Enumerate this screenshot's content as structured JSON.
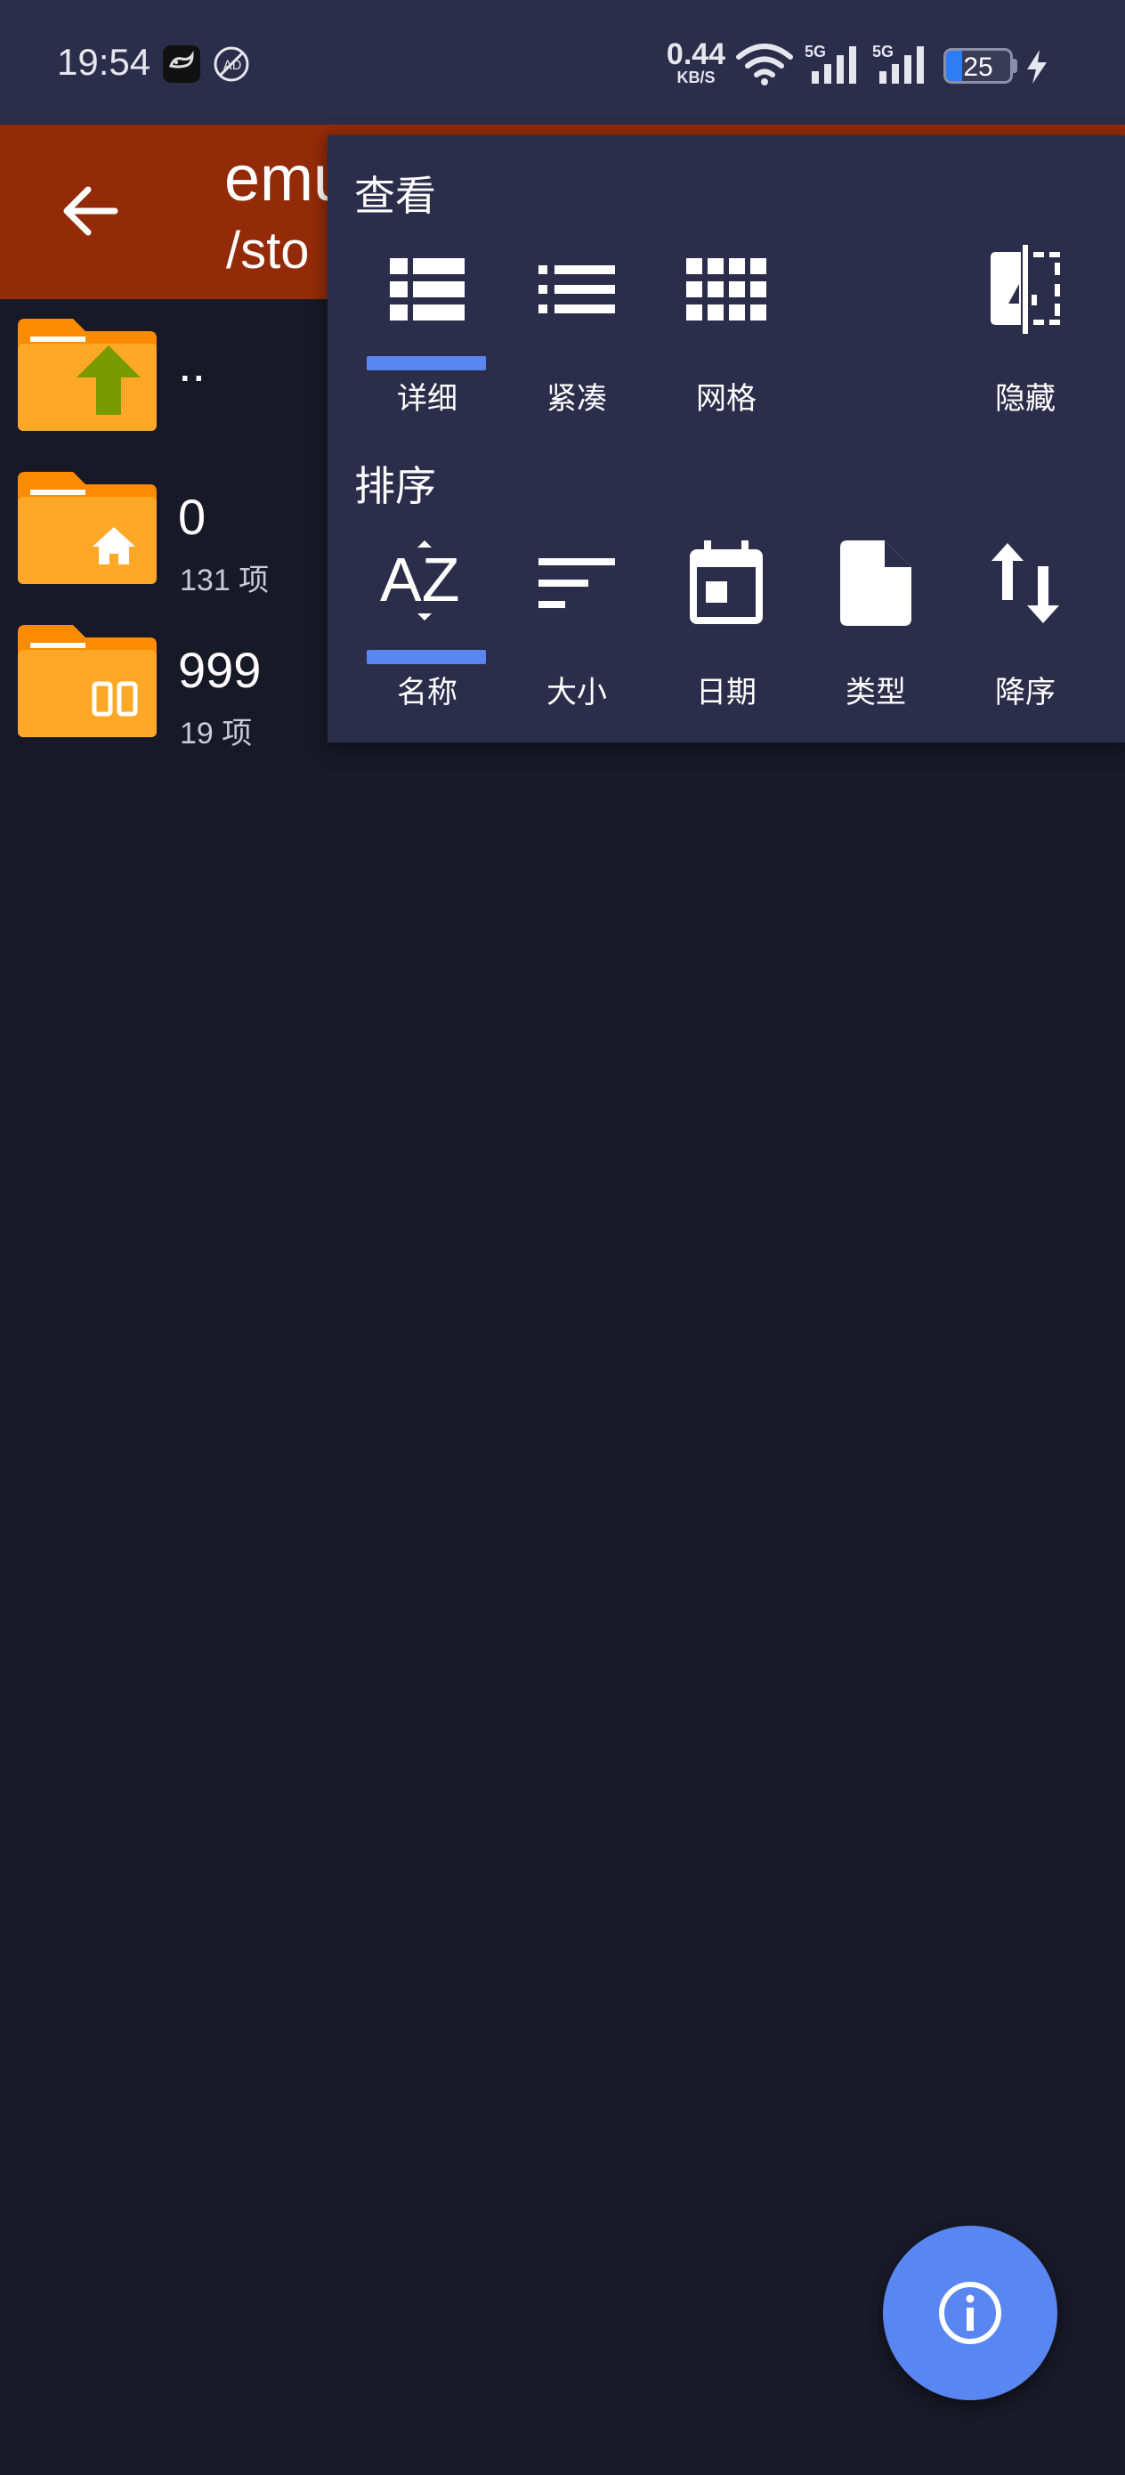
{
  "status_bar": {
    "time": "19:54",
    "net_speed_value": "0.44",
    "net_speed_unit": "KB/S",
    "signal_1_label": "5G",
    "signal_2_label": "5G",
    "battery_level": "25",
    "battery_fraction": 0.25,
    "icons": [
      "notification-app-icon",
      "ad-block-icon",
      "wifi-icon",
      "signal-icon",
      "signal-icon",
      "battery-icon",
      "charging-icon"
    ]
  },
  "app_bar": {
    "title_visible": "emu",
    "path_visible": "/sto"
  },
  "file_list": [
    {
      "name": "..",
      "count": "",
      "icon": "folder-up-icon"
    },
    {
      "name": "0",
      "count": "131 项",
      "icon": "folder-home-icon"
    },
    {
      "name": "999",
      "count": "19 项",
      "icon": "folder-dual-icon"
    }
  ],
  "popup": {
    "view_title": "查看",
    "view_options": [
      {
        "label": "详细",
        "icon": "list-detail-icon",
        "selected": true
      },
      {
        "label": "紧凑",
        "icon": "list-compact-icon",
        "selected": false
      },
      {
        "label": "网格",
        "icon": "grid-icon",
        "selected": false
      },
      {
        "label": "隐藏",
        "icon": "hidden-files-icon",
        "selected": false
      }
    ],
    "sort_title": "排序",
    "sort_options": [
      {
        "label": "名称",
        "icon": "sort-az-icon",
        "selected": true
      },
      {
        "label": "大小",
        "icon": "sort-size-icon",
        "selected": false
      },
      {
        "label": "日期",
        "icon": "calendar-icon",
        "selected": false
      },
      {
        "label": "类型",
        "icon": "file-type-icon",
        "selected": false
      },
      {
        "label": "降序",
        "icon": "sort-order-icon",
        "selected": false
      }
    ]
  },
  "fab": {
    "icon": "info-icon"
  },
  "colors": {
    "background": "#181926",
    "status_bar": "#2c2d4a",
    "app_bar": "#932b08",
    "popup": "#2c2d4a",
    "accent": "#5a86f2",
    "folder": "#ffa726",
    "folder_tab": "#fb8c00"
  }
}
